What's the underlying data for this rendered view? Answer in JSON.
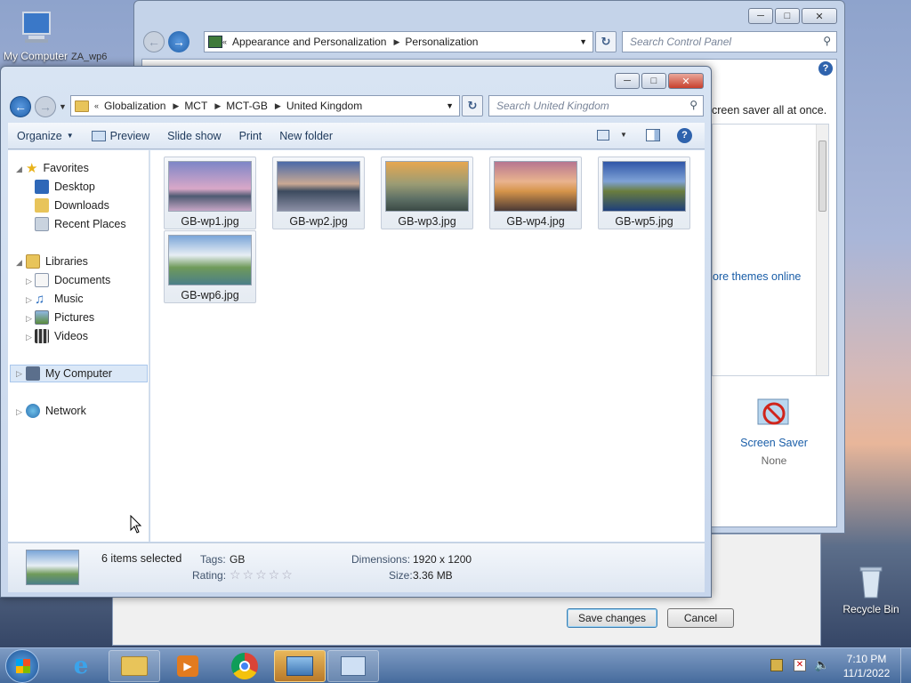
{
  "desktop": {
    "my_computer_label": "My Computer",
    "recycle_bin_label": "Recycle Bin",
    "partial_window_label": "ZA_wp6"
  },
  "control_panel": {
    "breadcrumb": [
      "Appearance and Personalization",
      "Personalization"
    ],
    "search_placeholder": "Search Control Panel",
    "snippet_text": "creen saver all at once.",
    "link_text": "ore themes online",
    "screen_saver_label": "Screen Saver",
    "screen_saver_value": "None",
    "save_label": "Save changes",
    "cancel_label": "Cancel"
  },
  "dialog": {
    "breadcrumb": [
      "Globalization",
      "MCT",
      "MCT-GB",
      "United Kingdom"
    ],
    "search_placeholder": "Search United Kingdom",
    "toolbar": {
      "organize": "Organize",
      "preview": "Preview",
      "slideshow": "Slide show",
      "print": "Print",
      "new_folder": "New folder"
    },
    "nav": {
      "favorites": "Favorites",
      "desktop": "Desktop",
      "downloads": "Downloads",
      "recent": "Recent Places",
      "libraries": "Libraries",
      "documents": "Documents",
      "music": "Music",
      "pictures": "Pictures",
      "videos": "Videos",
      "computer": "My Computer",
      "network": "Network"
    },
    "files": [
      {
        "name": "GB-wp1.jpg"
      },
      {
        "name": "GB-wp2.jpg"
      },
      {
        "name": "GB-wp3.jpg"
      },
      {
        "name": "GB-wp4.jpg"
      },
      {
        "name": "GB-wp5.jpg"
      },
      {
        "name": "GB-wp6.jpg"
      }
    ],
    "details": {
      "selection": "6 items selected",
      "tags_label": "Tags:",
      "tags_value": "GB",
      "rating_label": "Rating:",
      "dimensions_label": "Dimensions:",
      "dimensions_value": "1920 x 1200",
      "size_label": "Size:",
      "size_value": "3.36 MB"
    }
  },
  "taskbar": {
    "time": "7:10 PM",
    "date": "11/1/2022"
  }
}
